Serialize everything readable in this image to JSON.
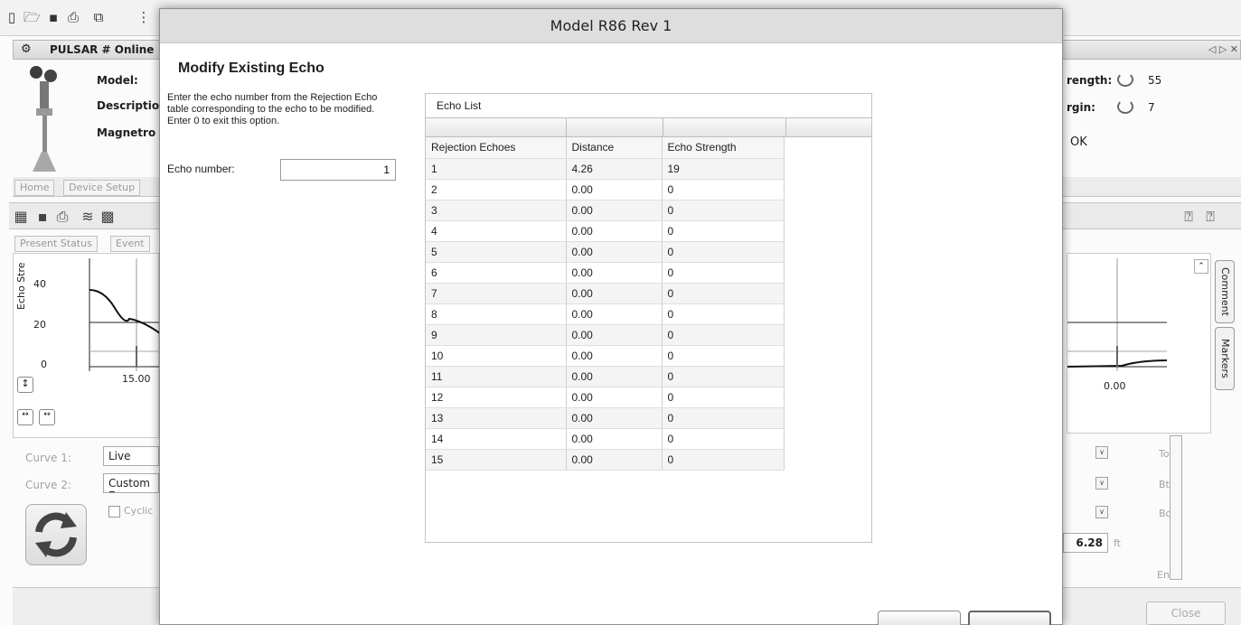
{
  "app": {
    "title": "PULSAR # Online",
    "model_label": "Model:",
    "description_label": "Descriptio",
    "magnetrol_label": "Magnetro",
    "strength_label": "rength:",
    "strength_value": "55",
    "margin_label": "rgin:",
    "margin_value": "7",
    "status_value": "OK",
    "tabs": [
      "Home",
      "Device Setup"
    ],
    "subtabs": [
      "Present Status",
      "Event"
    ],
    "nav_arrows": "◁ ▷ ✕"
  },
  "chart_left": {
    "y_label": "Echo Stre",
    "y_ticks": [
      "40",
      "20",
      "0"
    ],
    "x_tick": "15.00"
  },
  "chart_right": {
    "x_tick": "0.00"
  },
  "side_tabs": [
    "Comment",
    "Markers"
  ],
  "lower_panel": {
    "curve1_label": "Curve 1:",
    "curve1_value": "Live",
    "curve2_label": "Curve 2:",
    "curve2_value": "Custom E",
    "cyclic_label": "Cyclic",
    "distance_value": "6.28",
    "distance_unit": "ft",
    "to_label": "To",
    "btm_label": "Bt",
    "bo_label": "Bo",
    "en_label": "En",
    "close_label": "Close"
  },
  "dialog": {
    "title": "Model R86 Rev 1",
    "heading": "Modify Existing Echo",
    "instructions": "Enter the echo number from the Rejection Echo table corresponding to the echo to be modified. Enter 0 to exit this option.",
    "echo_number_label": "Echo number:",
    "echo_number_value": "1",
    "echo_list_title": "Echo List",
    "columns": [
      "Rejection Echoes",
      "Distance",
      "Echo Strength"
    ],
    "rows": [
      [
        "1",
        "4.26",
        "19"
      ],
      [
        "2",
        "0.00",
        "0"
      ],
      [
        "3",
        "0.00",
        "0"
      ],
      [
        "4",
        "0.00",
        "0"
      ],
      [
        "5",
        "0.00",
        "0"
      ],
      [
        "6",
        "0.00",
        "0"
      ],
      [
        "7",
        "0.00",
        "0"
      ],
      [
        "8",
        "0.00",
        "0"
      ],
      [
        "9",
        "0.00",
        "0"
      ],
      [
        "10",
        "0.00",
        "0"
      ],
      [
        "11",
        "0.00",
        "0"
      ],
      [
        "12",
        "0.00",
        "0"
      ],
      [
        "13",
        "0.00",
        "0"
      ],
      [
        "14",
        "0.00",
        "0"
      ],
      [
        "15",
        "0.00",
        "0"
      ]
    ]
  }
}
